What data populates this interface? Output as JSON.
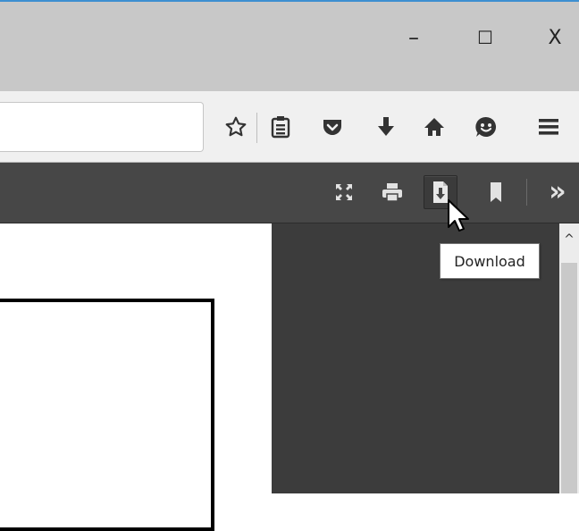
{
  "window": {
    "minimize_glyph": "–",
    "maximize_glyph": "☐",
    "close_glyph": "X"
  },
  "navbar": {
    "url_value": "",
    "icons": [
      "star-icon",
      "reading-list-icon",
      "pocket-icon",
      "download-icon",
      "home-icon",
      "smiley-icon",
      "hamburger-menu-icon"
    ]
  },
  "pdf_toolbar": {
    "icons": [
      "presentation-mode-icon",
      "print-icon",
      "download-icon",
      "bookmark-icon",
      "more-tools-icon"
    ],
    "overflow_glyph": "»",
    "active_button": "download"
  },
  "tooltip": {
    "text": "Download"
  },
  "scrollbar": {
    "up_glyph": "^"
  },
  "colors": {
    "titlebar": "#c8c8c8",
    "accent_border": "#3d8fd1",
    "navbar": "#f0f0f0",
    "pdf_toolbar": "#474747",
    "viewer_dark": "#3c3c3c"
  }
}
